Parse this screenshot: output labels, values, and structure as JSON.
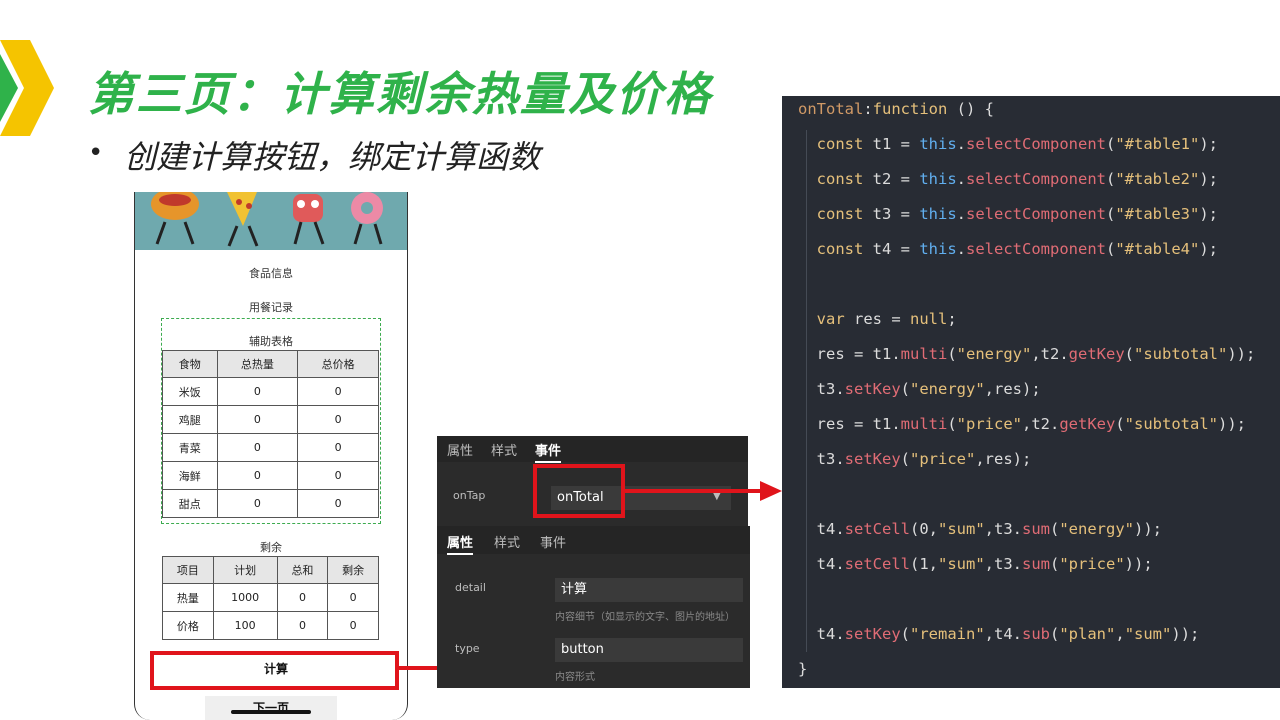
{
  "slide": {
    "title": "第三页：计算剩余热量及价格",
    "bullet": "创建计算按钮，绑定计算函数"
  },
  "phone": {
    "section_food": "食品信息",
    "section_meal": "用餐记录",
    "section_aux": "辅助表格",
    "table1": {
      "headers": [
        "食物",
        "总热量",
        "总价格"
      ],
      "rows": [
        [
          "米饭",
          "0",
          "0"
        ],
        [
          "鸡腿",
          "0",
          "0"
        ],
        [
          "青菜",
          "0",
          "0"
        ],
        [
          "海鲜",
          "0",
          "0"
        ],
        [
          "甜点",
          "0",
          "0"
        ]
      ]
    },
    "section_remain": "剩余",
    "table2": {
      "headers": [
        "项目",
        "计划",
        "总和",
        "剩余"
      ],
      "rows": [
        [
          "热量",
          "1000",
          "0",
          "0"
        ],
        [
          "价格",
          "100",
          "0",
          "0"
        ]
      ]
    },
    "calc_button": "计算",
    "next_button": "下一页"
  },
  "event_panel": {
    "tabs": [
      "属性",
      "样式",
      "事件"
    ],
    "active_tab": "事件",
    "ontap_label": "onTap",
    "ontap_value": "onTotal"
  },
  "prop_panel": {
    "tabs": [
      "属性",
      "样式",
      "事件"
    ],
    "active_tab": "属性",
    "detail_label": "detail",
    "detail_value": "计算",
    "detail_hint": "内容细节（如显示的文字、图片的地址）",
    "type_label": "type",
    "type_value": "button",
    "type_hint": "内容形式"
  },
  "code": {
    "lines": [
      "onTotal:function () {",
      "  const t1 = this.selectComponent(\"#table1\");",
      "  const t2 = this.selectComponent(\"#table2\");",
      "  const t3 = this.selectComponent(\"#table3\");",
      "  const t4 = this.selectComponent(\"#table4\");",
      "",
      "  var res = null;",
      "  res = t1.multi(\"energy\",t2.getKey(\"subtotal\"));",
      "  t3.setKey(\"energy\",res);",
      "  res = t1.multi(\"price\",t2.getKey(\"subtotal\"));",
      "  t3.setKey(\"price\",res);",
      "",
      "  t4.setCell(0,\"sum\",t3.sum(\"energy\"));",
      "  t4.setCell(1,\"sum\",t3.sum(\"price\"));",
      "",
      "  t4.setKey(\"remain\",t4.sub(\"plan\",\"sum\"));",
      "}"
    ]
  },
  "colors": {
    "title_green": "#2fb24a",
    "highlight_red": "#e0141b",
    "code_bg": "#282c34"
  }
}
